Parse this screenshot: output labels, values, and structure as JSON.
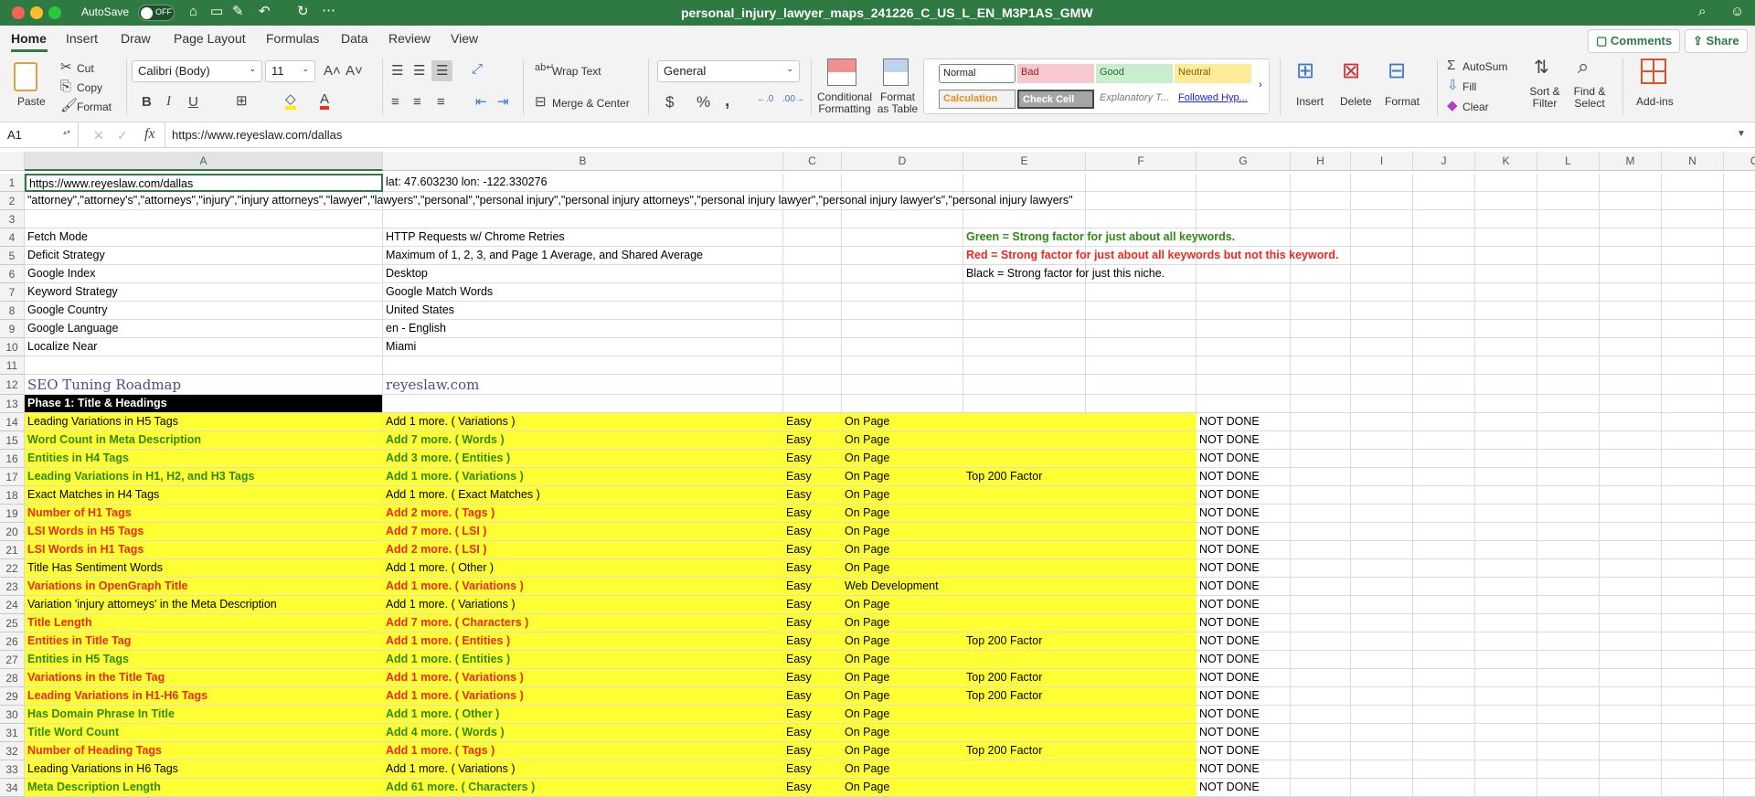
{
  "titlebar": {
    "autosave_label": "AutoSave",
    "autosave_state": "OFF",
    "file_name": "personal_injury_lawyer_maps_241226_C_US_L_EN_M3P1AS_GMW",
    "accent": "#2f7a43"
  },
  "ribbon": {
    "tabs": [
      "Home",
      "Insert",
      "Draw",
      "Page Layout",
      "Formulas",
      "Data",
      "Review",
      "View"
    ],
    "comments": "Comments",
    "share": "Share",
    "paste": "Paste",
    "cut": "Cut",
    "copy": "Copy",
    "format_painter": "Format",
    "font_name": "Calibri (Body)",
    "font_size": "11",
    "bold": "B",
    "italic": "I",
    "underline": "U",
    "wrap_text": "Wrap Text",
    "merge_center": "Merge & Center",
    "number_format": "General",
    "conditional_formatting": "Conditional Formatting",
    "format_as_table": "Format as Table",
    "styles": [
      "Normal",
      "Bad",
      "Good",
      "Neutral",
      "Calculation",
      "Check Cell",
      "Explanatory T...",
      "Followed Hyp..."
    ],
    "insert": "Insert",
    "delete": "Delete",
    "format": "Format",
    "autosum": "AutoSum",
    "fill": "Fill",
    "clear": "Clear",
    "sort_filter": "Sort & Filter",
    "find_select": "Find & Select",
    "addins": "Add-ins"
  },
  "formula_bar": {
    "name_box": "A1",
    "fx": "fx",
    "value": "https://www.reyeslaw.com/dallas"
  },
  "columns": [
    "A",
    "B",
    "C",
    "D",
    "E",
    "F",
    "G",
    "H",
    "I",
    "J",
    "K",
    "L",
    "M",
    "N",
    "O"
  ],
  "rows": [
    {
      "n": "1",
      "cells": {
        "A": "https://www.reyeslaw.com/dallas",
        "B": "lat: 47.603230  lon: -122.330276"
      }
    },
    {
      "n": "2",
      "cells": {
        "A": "\"attorney\",\"attorney's\",\"attorneys\",\"injury\",\"injury attorneys\",\"lawyer\",\"lawyers\",\"personal\",\"personal injury\",\"personal injury attorneys\",\"personal injury lawyer\",\"personal injury lawyer's\",\"personal injury lawyers\""
      }
    },
    {
      "n": "3",
      "cells": {}
    },
    {
      "n": "4",
      "cells": {
        "A": "Fetch Mode",
        "B": "HTTP Requests w/ Chrome Retries",
        "E": "Green = Strong factor for just about all keywords."
      },
      "ecolor": "green"
    },
    {
      "n": "5",
      "cells": {
        "A": "Deficit Strategy",
        "B": "Maximum of 1, 2, 3, and Page 1 Average, and Shared Average",
        "E": "Red = Strong factor for just about all keywords but not this keyword."
      },
      "ecolor": "red"
    },
    {
      "n": "6",
      "cells": {
        "A": "Google Index",
        "B": "Desktop",
        "E": "Black = Strong factor for just this niche."
      }
    },
    {
      "n": "7",
      "cells": {
        "A": "Keyword Strategy",
        "B": "Google Match Words"
      }
    },
    {
      "n": "8",
      "cells": {
        "A": "Google Country",
        "B": "United States"
      }
    },
    {
      "n": "9",
      "cells": {
        "A": "Google Language",
        "B": "en - English"
      }
    },
    {
      "n": "10",
      "cells": {
        "A": "Localize Near",
        "B": "Miami"
      }
    },
    {
      "n": "11",
      "cells": {}
    },
    {
      "n": "12",
      "cells": {
        "A": "SEO Tuning Roadmap",
        "B": "reyeslaw.com"
      },
      "kind": "title"
    },
    {
      "n": "13",
      "cells": {
        "A": "Phase 1: Title & Headings"
      },
      "kind": "phase"
    },
    {
      "n": "14",
      "color": "black",
      "cells": {
        "A": "Leading Variations in H5 Tags",
        "B": "Add 1 more. ( Variations )",
        "C": "Easy",
        "D": "On Page",
        "G": "NOT DONE"
      }
    },
    {
      "n": "15",
      "color": "green",
      "cells": {
        "A": "Word Count in Meta Description",
        "B": "Add 7 more. ( Words )",
        "C": "Easy",
        "D": "On Page",
        "G": "NOT DONE"
      }
    },
    {
      "n": "16",
      "color": "green",
      "cells": {
        "A": "Entities in H4 Tags",
        "B": "Add 3 more. ( Entities )",
        "C": "Easy",
        "D": "On Page",
        "G": "NOT DONE"
      }
    },
    {
      "n": "17",
      "color": "green",
      "cells": {
        "A": "Leading Variations in H1, H2, and H3 Tags",
        "B": "Add 1 more. ( Variations )",
        "C": "Easy",
        "D": "On Page",
        "E": "Top 200 Factor",
        "G": "NOT DONE"
      }
    },
    {
      "n": "18",
      "color": "black",
      "cells": {
        "A": "Exact Matches in H4 Tags",
        "B": "Add 1 more. ( Exact Matches )",
        "C": "Easy",
        "D": "On Page",
        "G": "NOT DONE"
      }
    },
    {
      "n": "19",
      "color": "red",
      "cells": {
        "A": "Number of H1 Tags",
        "B": "Add 2 more. ( Tags )",
        "C": "Easy",
        "D": "On Page",
        "G": "NOT DONE"
      }
    },
    {
      "n": "20",
      "color": "red",
      "cells": {
        "A": "LSI Words in H5 Tags",
        "B": "Add 7 more. ( LSI )",
        "C": "Easy",
        "D": "On Page",
        "G": "NOT DONE"
      }
    },
    {
      "n": "21",
      "color": "red",
      "cells": {
        "A": "LSI Words in H1 Tags",
        "B": "Add 2 more. ( LSI )",
        "C": "Easy",
        "D": "On Page",
        "G": "NOT DONE"
      }
    },
    {
      "n": "22",
      "color": "black",
      "cells": {
        "A": "Title Has Sentiment Words",
        "B": "Add 1 more. ( Other )",
        "C": "Easy",
        "D": "On Page",
        "G": "NOT DONE"
      }
    },
    {
      "n": "23",
      "color": "red",
      "cells": {
        "A": "Variations in OpenGraph Title",
        "B": "Add 1 more. ( Variations )",
        "C": "Easy",
        "D": "Web Development",
        "G": "NOT DONE"
      }
    },
    {
      "n": "24",
      "color": "black",
      "cells": {
        "A": "Variation 'injury attorneys' in the Meta Description",
        "B": "Add 1 more. ( Variations )",
        "C": "Easy",
        "D": "On Page",
        "G": "NOT DONE"
      }
    },
    {
      "n": "25",
      "color": "red",
      "cells": {
        "A": "Title Length",
        "B": "Add 7 more. ( Characters )",
        "C": "Easy",
        "D": "On Page",
        "G": "NOT DONE"
      }
    },
    {
      "n": "26",
      "color": "red",
      "cells": {
        "A": "Entities in Title Tag",
        "B": "Add 1 more. ( Entities )",
        "C": "Easy",
        "D": "On Page",
        "E": "Top 200 Factor",
        "G": "NOT DONE"
      }
    },
    {
      "n": "27",
      "color": "green",
      "cells": {
        "A": "Entities in H5 Tags",
        "B": "Add 1 more. ( Entities )",
        "C": "Easy",
        "D": "On Page",
        "G": "NOT DONE"
      }
    },
    {
      "n": "28",
      "color": "red",
      "cells": {
        "A": "Variations in the Title Tag",
        "B": "Add 1 more. ( Variations )",
        "C": "Easy",
        "D": "On Page",
        "E": "Top 200 Factor",
        "G": "NOT DONE"
      }
    },
    {
      "n": "29",
      "color": "red",
      "cells": {
        "A": "Leading Variations in H1-H6 Tags",
        "B": "Add 1 more. ( Variations )",
        "C": "Easy",
        "D": "On Page",
        "E": "Top 200 Factor",
        "G": "NOT DONE"
      }
    },
    {
      "n": "30",
      "color": "green",
      "cells": {
        "A": "Has Domain Phrase In Title",
        "B": "Add 1 more. ( Other )",
        "C": "Easy",
        "D": "On Page",
        "G": "NOT DONE"
      }
    },
    {
      "n": "31",
      "color": "green",
      "cells": {
        "A": "Title Word Count",
        "B": "Add 4 more. ( Words )",
        "C": "Easy",
        "D": "On Page",
        "G": "NOT DONE"
      }
    },
    {
      "n": "32",
      "color": "red",
      "cells": {
        "A": "Number of Heading Tags",
        "B": "Add 1 more. ( Tags )",
        "C": "Easy",
        "D": "On Page",
        "E": "Top 200 Factor",
        "G": "NOT DONE"
      }
    },
    {
      "n": "33",
      "color": "black",
      "cells": {
        "A": "Leading Variations in H6 Tags",
        "B": "Add 1 more. ( Variations )",
        "C": "Easy",
        "D": "On Page",
        "G": "NOT DONE"
      }
    },
    {
      "n": "34",
      "color": "green",
      "cells": {
        "A": "Meta Description Length",
        "B": "Add 61 more. ( Characters )",
        "C": "Easy",
        "D": "On Page",
        "G": "NOT DONE"
      }
    }
  ],
  "colors": {
    "highlight": "#ffff33",
    "green": "#2e8b13",
    "red": "#f0281e",
    "title": "#4a4f8c"
  }
}
